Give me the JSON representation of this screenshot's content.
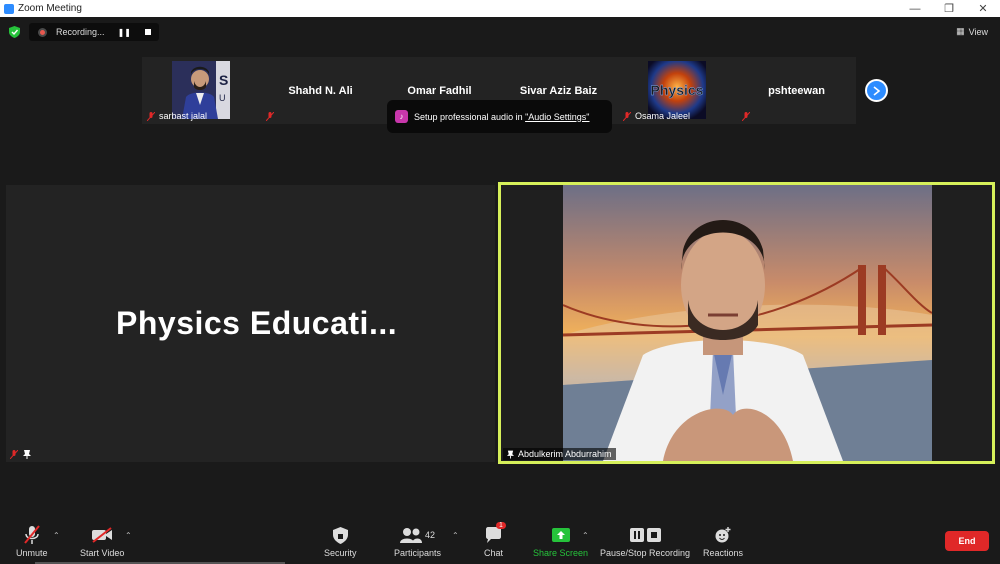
{
  "window": {
    "title": "Zoom Meeting",
    "minimize": "—",
    "restore": "❐",
    "close": "✕"
  },
  "recording": {
    "label": "Recording..."
  },
  "view": {
    "label": "View"
  },
  "participants_strip": [
    {
      "name": "",
      "label": "sarbast jalal",
      "has_video": true
    },
    {
      "name": "Shahd N. Ali",
      "label": "",
      "has_video": false
    },
    {
      "name": "Omar Fadhil",
      "label": "",
      "has_video": false
    },
    {
      "name": "Sivar Aziz Baiz",
      "label": "",
      "has_video": false
    },
    {
      "name": "",
      "label": "Osama Jaleel",
      "has_video": true,
      "thumb_text": "Physics"
    },
    {
      "name": "pshteewan",
      "label": "",
      "has_video": false
    }
  ],
  "toast": {
    "text_before": "Setup professional audio in ",
    "link": "\"Audio Settings\""
  },
  "share_tile": {
    "title": "Physics  Educati..."
  },
  "speaker": {
    "name": "Abdulkerim Abdurrahim"
  },
  "toolbar": {
    "unmute": "Unmute",
    "start_video": "Start Video",
    "security": "Security",
    "participants": "Participants",
    "participants_count": "42",
    "chat": "Chat",
    "chat_badge": "1",
    "share_screen": "Share Screen",
    "pause_stop": "Pause/Stop Recording",
    "reactions": "Reactions",
    "end": "End"
  },
  "colors": {
    "share_green": "#26c33b",
    "end_red": "#e02828",
    "accent_blue": "#2d8cff",
    "active_border": "#d6f05a"
  }
}
